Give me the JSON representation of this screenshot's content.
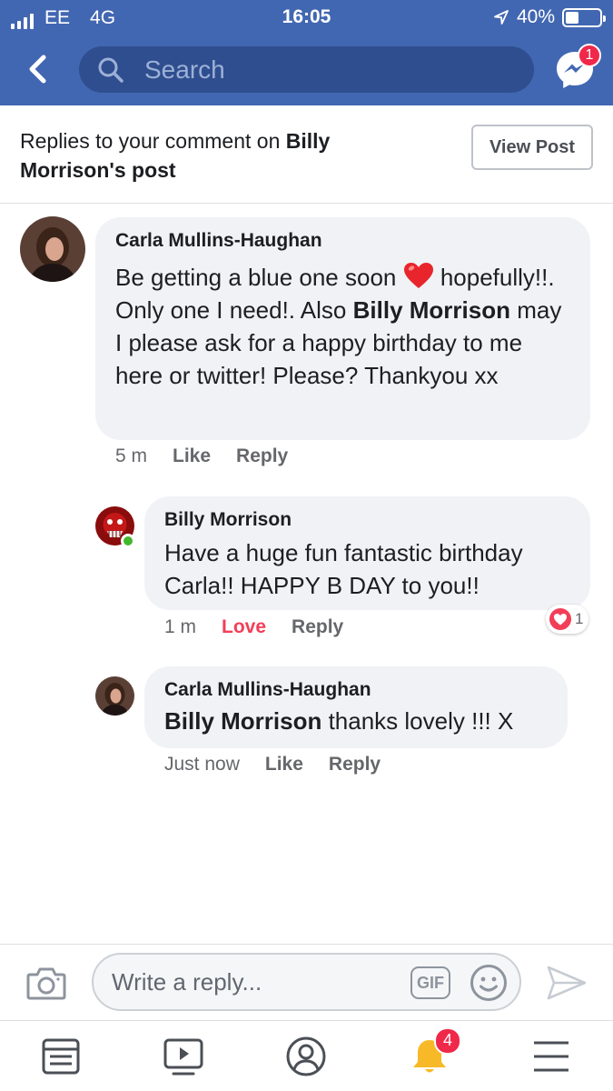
{
  "status_bar": {
    "carrier": "EE",
    "network": "4G",
    "time": "16:05",
    "battery": "40%",
    "battery_level": 0.4
  },
  "header": {
    "search_placeholder": "Search",
    "messenger_badge": "1",
    "accent_color": "#4267b2"
  },
  "context": {
    "prefix": "Replies to your comment on ",
    "post_owner": "Billy Morrison",
    "suffix": "'s post",
    "view_post_label": "View Post"
  },
  "comments": [
    {
      "author": "Carla Mullins-Haughan",
      "text_part1": "Be getting a blue one soon ",
      "emoji_icon": "red-heart",
      "text_part2": " hopefully!!. Only one I need!. Also ",
      "mention": "Billy Morrison",
      "text_part3": " may I please ask for a happy birthday to me here or twitter! Please? Thankyou xx",
      "time": "5 m",
      "like_label": "Like",
      "reply_label": "Reply"
    },
    {
      "author": "Billy Morrison",
      "online": true,
      "text": "Have a huge fun fantastic birthday Carla!! HAPPY B DAY to you!!",
      "time": "1 m",
      "like_label": "Love",
      "reply_label": "Reply",
      "reaction_count": "1"
    },
    {
      "author": "Carla Mullins-Haughan",
      "mention": "Billy Morrison",
      "text": " thanks lovely !!! X",
      "time": "Just now",
      "like_label": "Like",
      "reply_label": "Reply"
    }
  ],
  "composer": {
    "placeholder": "Write a reply...",
    "gif_label": "GIF"
  },
  "bottom_nav": {
    "items": [
      "news-feed-icon",
      "watch-icon",
      "profile-icon",
      "notifications-icon",
      "menu-icon"
    ],
    "notifications_badge": "4"
  }
}
